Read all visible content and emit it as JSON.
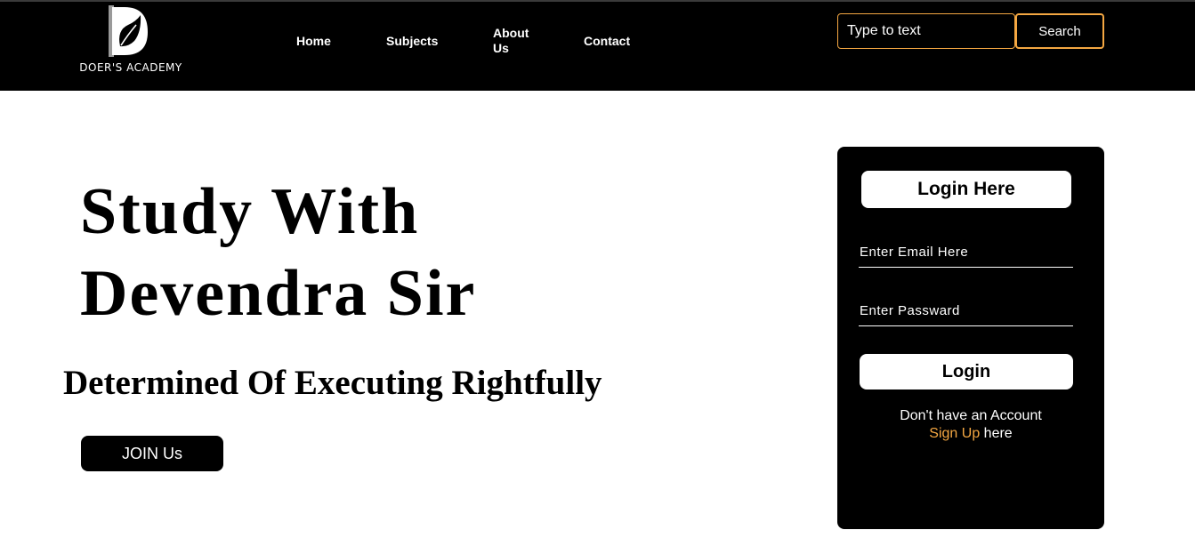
{
  "brand": {
    "name": "DOER'S ACADEMY",
    "accent_color": "#f4a742"
  },
  "nav": {
    "items": [
      {
        "label": "Home"
      },
      {
        "label": "Subjects"
      },
      {
        "label": "About Us"
      },
      {
        "label": "Contact"
      }
    ]
  },
  "search": {
    "placeholder": "Type to text",
    "button_label": "Search"
  },
  "hero": {
    "title_line1": "Study With",
    "title_line2": "Devendra Sir",
    "subtitle": "Determined Of Executing Rightfully",
    "join_label": "JOIN Us"
  },
  "login": {
    "heading": "Login Here",
    "email_placeholder": "Enter Email Here",
    "password_placeholder": "Enter Passward",
    "button_label": "Login",
    "account_prompt": "Don't have an Account",
    "signup_label": "Sign Up",
    "signup_suffix": " here"
  }
}
